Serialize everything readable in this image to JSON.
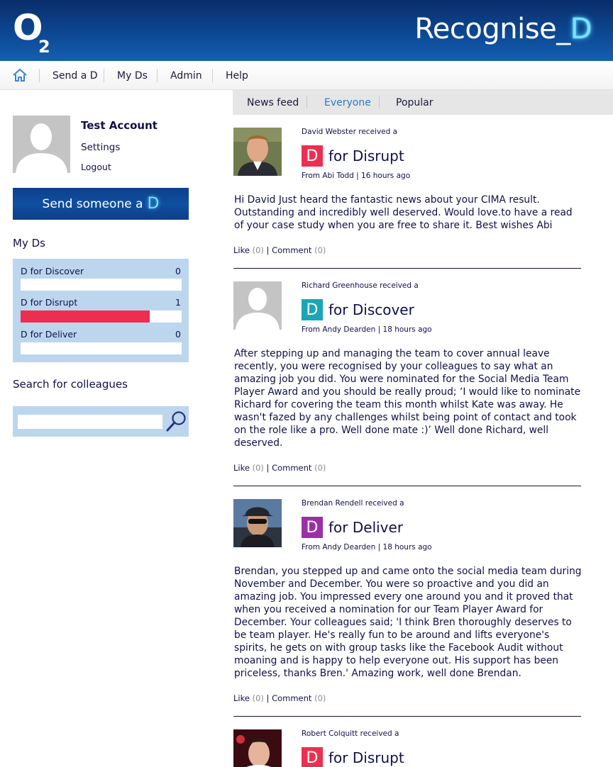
{
  "header": {
    "logo_main": "O",
    "logo_sub": "2",
    "brand_text": "Recognise_",
    "brand_d": "D"
  },
  "nav": {
    "items": [
      "Send a D",
      "My Ds",
      "Admin",
      "Help"
    ]
  },
  "subtabs": {
    "items": [
      "News feed",
      "Everyone",
      "Popular"
    ],
    "active": "Everyone"
  },
  "account": {
    "name": "Test Account",
    "settings": "Settings",
    "logout": "Logout"
  },
  "send_button": {
    "label": "Send someone a",
    "d": "D"
  },
  "my_ds": {
    "title": "My Ds",
    "items": [
      {
        "label": "D for Discover",
        "count": "0",
        "fraction": 0,
        "color": "#ee2e50"
      },
      {
        "label": "D for Disrupt",
        "count": "1",
        "fraction": 0.8,
        "color": "#ee2e50"
      },
      {
        "label": "D for Deliver",
        "count": "0",
        "fraction": 0,
        "color": "#ee2e50"
      }
    ]
  },
  "search": {
    "title": "Search for colleagues",
    "placeholder": ""
  },
  "feed": [
    {
      "received": "David Webster received a",
      "award_letter": "D",
      "award_text": "for Disrupt",
      "award_color": "#ee2e50",
      "from": "From Abi Todd | 16 hours ago",
      "message": "Hi David Just heard the fantastic news about your CIMA result. Outstanding and incredibly well deserved. Would love.to have a read of your case study when you are free to share it. Best wishes Abi",
      "like": "Like",
      "like_count": "(0)",
      "comment": "Comment",
      "comment_count": "(0)"
    },
    {
      "received": "Richard Greenhouse received a",
      "award_letter": "D",
      "award_text": "for Discover",
      "award_color": "#1aa6b7",
      "from": "From Andy Dearden | 18 hours ago",
      "message": "After stepping up and managing the team to cover annual leave recently, you were recognised by your colleagues to say what an amazing job you did. You were nominated for the Social Media Team Player Award and you should be really proud; ‘I would like to nominate Richard for covering the team this month whilst Kate was away. He wasn't fazed by any challenges whilst being point of contact and took on the role like a pro. Well done mate :)’ Well done Richard, well deserved.",
      "like": "Like",
      "like_count": "(0)",
      "comment": "Comment",
      "comment_count": "(0)"
    },
    {
      "received": "Brendan Rendell received a",
      "award_letter": "D",
      "award_text": "for Deliver",
      "award_color": "#9b2fa8",
      "from": "From Andy Dearden | 18 hours ago",
      "message": "Brendan, you stepped up and came onto the social media team during November and December. You were so proactive and you did an amazing job. You impressed every one around you and it proved that when you received a nomination for our Team Player Award for December. Your colleagues said; 'I think Bren thoroughly deserves to be team player. He's really fun to be around and lifts everyone's spirits, he gets on with group tasks like the Facebook Audit without moaning and is happy to help everyone out. His support has been priceless, thanks Bren.' Amazing work, well done Brendan.",
      "like": "Like",
      "like_count": "(0)",
      "comment": "Comment",
      "comment_count": "(0)"
    },
    {
      "received": "Robert Colquitt received a",
      "award_letter": "D",
      "award_text": "for Disrupt",
      "award_color": "#ee2e50"
    }
  ]
}
